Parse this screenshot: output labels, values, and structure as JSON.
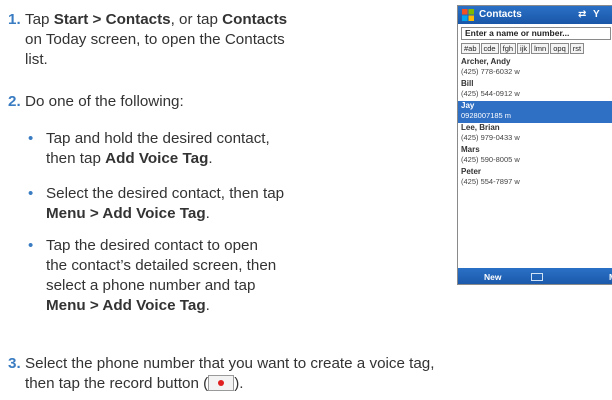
{
  "steps": {
    "s1": {
      "num": "1.",
      "lines": [
        [
          "Tap ",
          "Start > Contacts",
          ", or tap ",
          "Contacts"
        ],
        [
          "on Today screen, to open the Contacts"
        ],
        [
          "list."
        ]
      ]
    },
    "s2": {
      "num": "2.",
      "lead": "Do one of the following:",
      "bullets": [
        {
          "l1": "Tap and hold the desired contact,",
          "l2_pre": "then tap ",
          "l2_bold": "Add Voice Tag",
          "l2_post": "."
        },
        {
          "l1": "Select the desired contact, then tap",
          "l2_bold": "Menu > Add Voice Tag",
          "l2_post": "."
        },
        {
          "l1": "Tap the desired contact to open",
          "l2": "the contact’s detailed screen, then",
          "l3": "select a phone number and tap",
          "l4_bold": "Menu > Add Voice Tag",
          "l4_post": "."
        }
      ]
    },
    "s3": {
      "num": "3.",
      "l1": "Select the phone number that you want to create a voice tag,",
      "l2_pre": "then tap the record button (",
      "l2_post": ")."
    }
  },
  "phone": {
    "title": "Contacts",
    "status": "⇄ Y",
    "search_placeholder": "Enter a name or number...",
    "tabs": [
      "#ab",
      "cde",
      "fgh",
      "ijk",
      "lmn",
      "opq",
      "rst"
    ],
    "contacts": [
      {
        "name": "Archer, Andy",
        "phone": "(425) 778-6032  w",
        "selected": false
      },
      {
        "name": "Bill",
        "phone": "(425) 544-0912  w",
        "selected": false
      },
      {
        "name": "Jay",
        "phone": "0928007185  m",
        "selected": true
      },
      {
        "name": "Lee, Brian",
        "phone": "(425) 979-0433  w",
        "selected": false
      },
      {
        "name": "Mars",
        "phone": "(425) 590-8005  w",
        "selected": false
      },
      {
        "name": "Peter",
        "phone": "(425) 554-7897  w",
        "selected": false
      }
    ],
    "menu_left": "New",
    "menu_right": "M"
  },
  "icons": {
    "bullet": "bullet-dot",
    "record": "record-icon",
    "windows_logo": "windows-flag-icon"
  },
  "colors": {
    "accent": "#3a7cc2",
    "phone_bar": "#1f60b4",
    "selection": "#2f6fc4",
    "record": "#e02020"
  }
}
